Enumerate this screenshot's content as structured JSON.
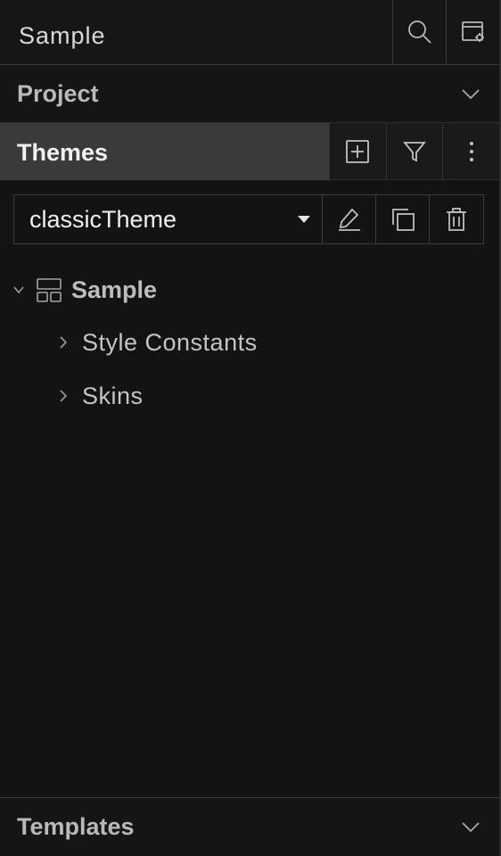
{
  "topbar": {
    "title": "Sample",
    "icons": [
      "search-icon",
      "window-settings-icon"
    ]
  },
  "sections": {
    "project": {
      "label": "Project",
      "icon": "chevron-down-icon"
    },
    "themes": {
      "label": "Themes",
      "icons": [
        "add-square-icon",
        "filter-icon",
        "more-vertical-icon"
      ]
    },
    "templates": {
      "label": "Templates",
      "icon": "chevron-down-icon"
    }
  },
  "theme_selector": {
    "value": "classicTheme",
    "icons": [
      "edit-pencil-icon",
      "duplicate-icon",
      "trash-icon"
    ]
  },
  "tree": {
    "root": {
      "label": "Sample",
      "icon": "layout-grid-icon",
      "expanded": true
    },
    "children": [
      {
        "label": "Style Constants",
        "expanded": false
      },
      {
        "label": "Skins",
        "expanded": false
      }
    ]
  }
}
